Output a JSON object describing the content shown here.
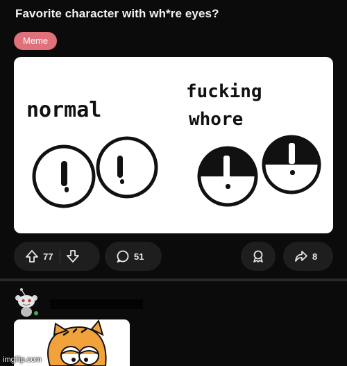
{
  "post": {
    "title": "Favorite character with wh*re eyes?",
    "flair": "Meme",
    "image": {
      "left_caption": "normal",
      "right_caption_line1": "fucking",
      "right_caption_line2": "whore"
    }
  },
  "actions": {
    "upvotes": "77",
    "comments": "51",
    "shares": "8"
  },
  "watermark": "imgflip.com",
  "colors": {
    "background": "#0b0b0b",
    "flair": "#e0717a",
    "pill": "#1e1e1e",
    "online": "#3fae52"
  },
  "icons": [
    "upvote-icon",
    "downvote-icon",
    "comment-icon",
    "award-icon",
    "share-icon",
    "snoo-avatar-icon"
  ]
}
